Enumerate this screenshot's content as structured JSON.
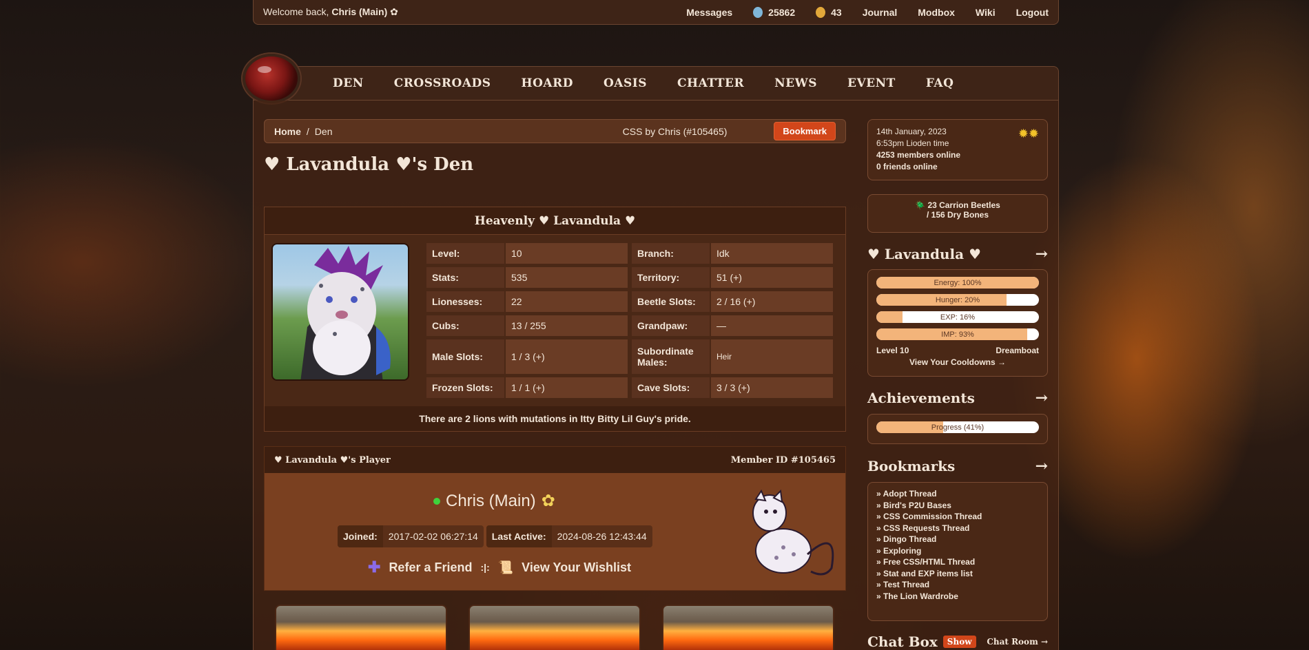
{
  "topbar": {
    "welcome_prefix": "Welcome back,",
    "user": "Chris (Main)",
    "messages": "Messages",
    "beetles": "25862",
    "gold": "43",
    "journal": "Journal",
    "modbox": "Modbox",
    "wiki": "Wiki",
    "logout": "Logout"
  },
  "nav": [
    "DEN",
    "CROSSROADS",
    "HOARD",
    "OASIS",
    "CHATTER",
    "NEWS",
    "EVENT",
    "FAQ"
  ],
  "breadcrumb": {
    "home": "Home",
    "sep": "/",
    "current": "Den",
    "css_credit": "CSS by Chris (#105465)",
    "bookmark": "Bookmark"
  },
  "den_title": "♥ Lavandula ♥'s Den",
  "profile": {
    "name": "Heavenly ♥ Lavandula ♥",
    "stats": [
      [
        {
          "k": "Level:",
          "v": "10"
        },
        {
          "k": "Branch:",
          "v": "Idk"
        }
      ],
      [
        {
          "k": "Stats:",
          "v": "535"
        },
        {
          "k": "Territory:",
          "v": "51 (+)"
        }
      ],
      [
        {
          "k": "Lionesses:",
          "v": "22"
        },
        {
          "k": "Beetle Slots:",
          "v": "2 / 16 (+)"
        }
      ],
      [
        {
          "k": "Cubs:",
          "v": "13 / 255"
        },
        {
          "k": "Grandpaw:",
          "v": "—"
        }
      ],
      [
        {
          "k": "Male Slots:",
          "v": "1 / 3 (+)"
        },
        {
          "k": "Subordinate Males:",
          "v": "Heir"
        }
      ],
      [
        {
          "k": "Frozen Slots:",
          "v": "1 / 1 (+)"
        },
        {
          "k": "Cave Slots:",
          "v": "3 / 3 (+)"
        }
      ]
    ],
    "footer": "There are 2 lions with mutations in Itty Bitty Lil Guy's pride."
  },
  "player": {
    "header": "♥ Lavandula ♥'s Player",
    "member_id": "Member ID #105465",
    "name": "Chris (Main)",
    "joined_label": "Joined:",
    "joined": "2017-02-02 06:27:14",
    "active_label": "Last Active:",
    "active": "2024-08-26 12:43:44",
    "refer": "Refer a Friend",
    "divider": ":|:",
    "wishlist": "View Your Wishlist"
  },
  "sidebar": {
    "date": "14th January, 2023",
    "time": "6:53pm Lioden time",
    "members": "4253 members online",
    "friends": "0 friends online",
    "beetles": "23 Carrion Beetles",
    "bones": "156 Dry Bones",
    "lion_name": "♥ Lavandula ♥",
    "arrow": "→",
    "bars": [
      {
        "label": "Energy: 100%",
        "value": 1.0
      },
      {
        "label": "Hunger: 20%",
        "value": 0.8
      },
      {
        "label": "EXP: 16%",
        "value": 0.16
      },
      {
        "label": "IMP: 93%",
        "value": 0.93
      }
    ],
    "level": "Level 10",
    "rank": "Dreamboat",
    "cooldowns": "View Your Cooldowns →",
    "achievements": "Achievements",
    "progress": {
      "label": "Progress (41%)",
      "value": 0.41
    },
    "bookmarks_title": "Bookmarks",
    "bookmarks": [
      "» Adopt Thread",
      "» Bird's P2U Bases",
      "» CSS Commission Thread",
      "» CSS Requests Thread",
      "» Dingo Thread",
      "» Exploring",
      "» Free CSS/HTML Thread",
      "» Stat and EXP items list",
      "» Test Thread",
      "» The Lion Wardrobe"
    ],
    "chat_title": "Chat Box",
    "chat_show": "Show",
    "chat_room": "Chat Room →"
  }
}
